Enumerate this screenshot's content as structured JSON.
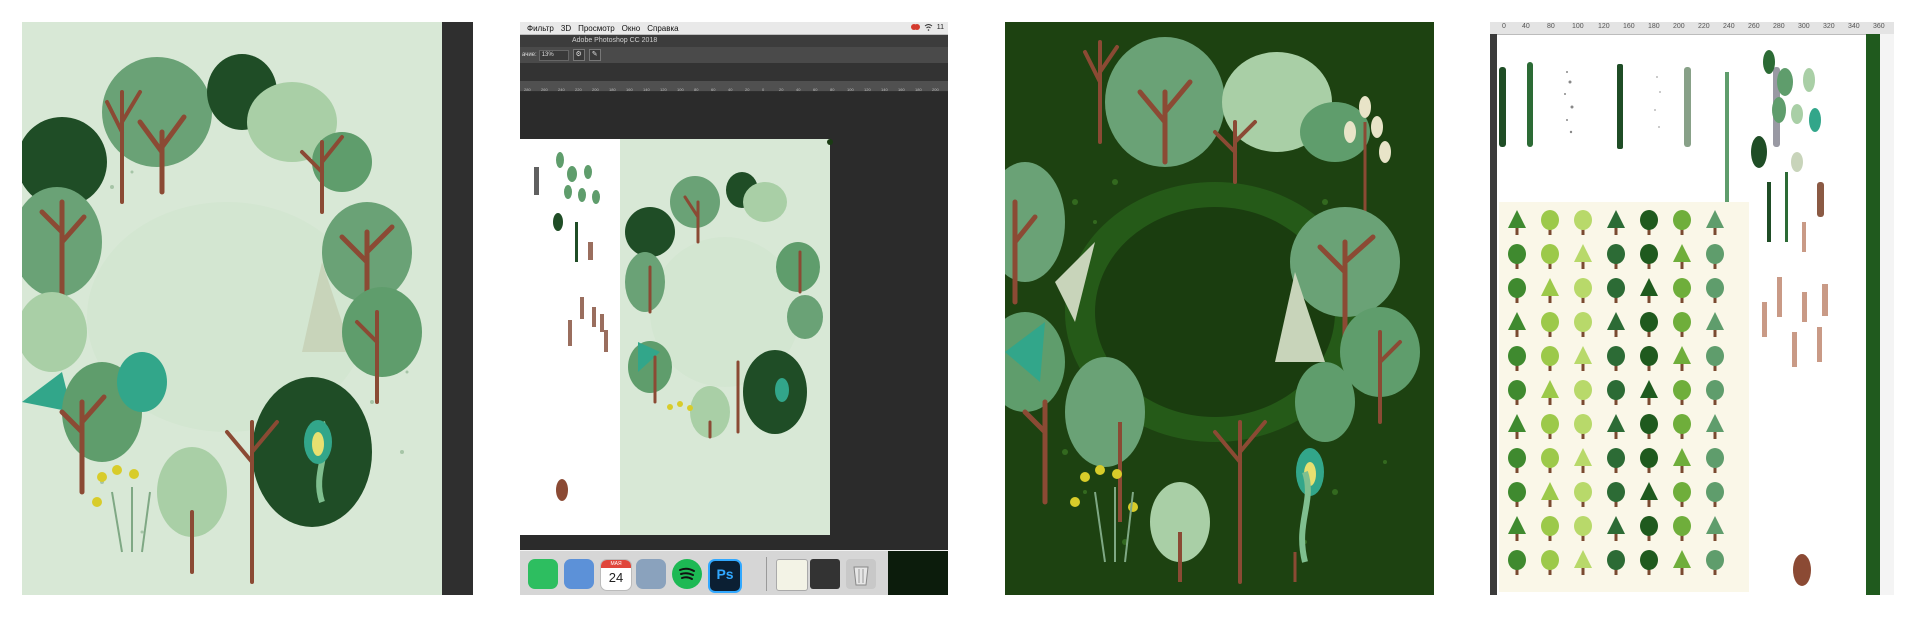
{
  "photoshop": {
    "menubar": {
      "items": [
        "Фильтр",
        "3D",
        "Просмотр",
        "Окно",
        "Справка"
      ],
      "clock": "11"
    },
    "title": "Adobe Photoshop CC 2018",
    "options": {
      "opacity_label": "ачие:",
      "opacity_value": "13%"
    },
    "ruler_numbers": [
      "280",
      "260",
      "240",
      "220",
      "200",
      "180",
      "160",
      "140",
      "120",
      "100",
      "80",
      "60",
      "40",
      "20",
      "0",
      "20",
      "40",
      "60",
      "80",
      "100",
      "120",
      "140",
      "160",
      "180",
      "200"
    ],
    "calendar": {
      "month": "МАЯ",
      "day": "24"
    },
    "ps_app_icon": "Ps",
    "dock_icons": [
      "evernote-icon",
      "keynote-icon",
      "calendar-icon",
      "preview-icon",
      "spotify-icon",
      "photoshop-icon",
      "document-icon",
      "screenshot-icon",
      "trash-icon"
    ]
  },
  "brush_sheet": {
    "ruler_numbers": [
      "0",
      "40",
      "80",
      "100",
      "120",
      "160",
      "180",
      "200",
      "220",
      "240",
      "260",
      "280",
      "300",
      "320",
      "340",
      "360"
    ]
  },
  "colors": {
    "canvas_light": "#d8e8d6",
    "canvas_dark": "#1d4211",
    "tree_green": "#5f9d6c",
    "tree_light": "#a9cfa6",
    "trunk": "#8b4a34",
    "teal": "#32a68a"
  }
}
